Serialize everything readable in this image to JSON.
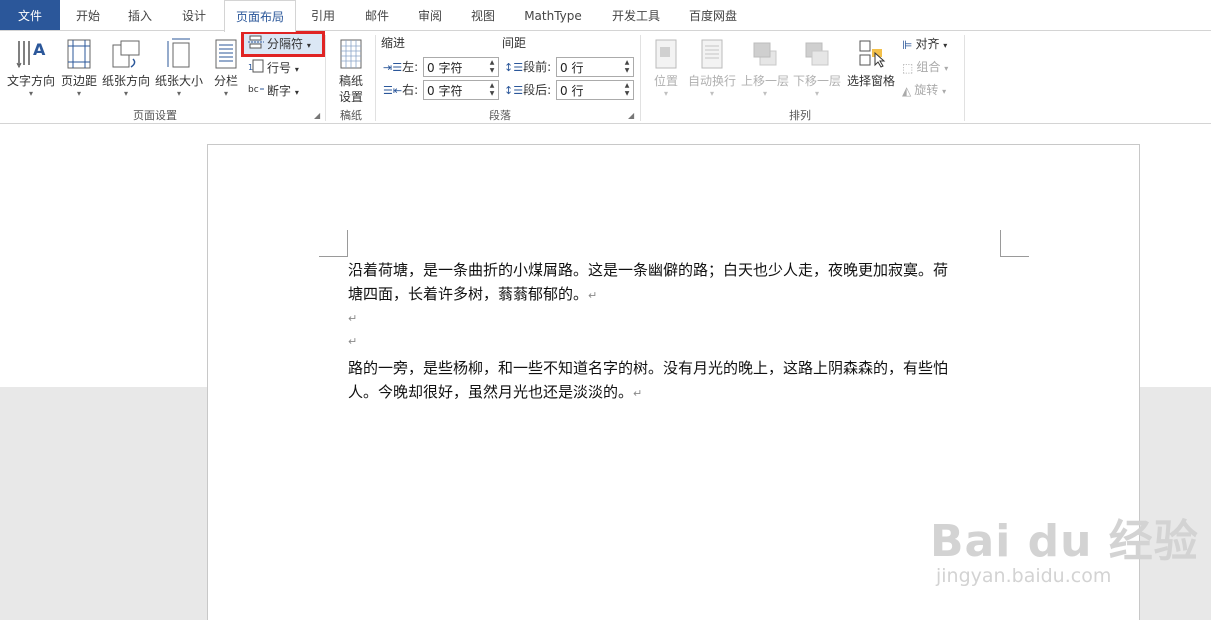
{
  "tabs": [
    "文件",
    "开始",
    "插入",
    "设计",
    "页面布局",
    "引用",
    "邮件",
    "审阅",
    "视图",
    "MathType",
    "开发工具",
    "百度网盘"
  ],
  "page_setup": {
    "text_direction": "文字方向",
    "margins": "页边距",
    "orientation": "纸张方向",
    "size": "纸张大小",
    "columns": "分栏",
    "breaks": "分隔符",
    "line_numbers": "行号",
    "hyphenation": "断字",
    "group_label": "页面设置"
  },
  "draft": {
    "button": "稿纸\n设置",
    "group_label": "稿纸"
  },
  "paragraph": {
    "indent_title": "缩进",
    "spacing_title": "间距",
    "left_label": "左:",
    "right_label": "右:",
    "left_value": "0 字符",
    "right_value": "0 字符",
    "before_label": "段前:",
    "after_label": "段后:",
    "before_value": "0 行",
    "after_value": "0 行",
    "group_label": "段落"
  },
  "arrange": {
    "position": "位置",
    "wrap_text": "自动换行",
    "bring_forward": "上移一层",
    "send_backward": "下移一层",
    "selection_pane": "选择窗格",
    "align": "对齐",
    "group": "组合",
    "rotate": "旋转",
    "group_label": "排列"
  },
  "document": {
    "para1_line1": "沿着荷塘，是一条曲折的小煤屑路。这是一条幽僻的路；白天也少人走，夜晚更加寂寞。荷",
    "para1_line2": "塘四面，长着许多树，蓊蓊郁郁的。",
    "para2_line1": "路的一旁，是些杨柳，和一些不知道名字的树。没有月光的晚上，这路上阴森森的，有些怕",
    "para2_line2": "人。今晚却很好，虽然月光也还是淡淡的。",
    "para_mark": "↵"
  },
  "watermark": {
    "logo": "Bai du 经验",
    "url": "jingyan.baidu.com"
  },
  "colors": {
    "file_tab": "#2b579a",
    "highlight": "#e02424"
  }
}
